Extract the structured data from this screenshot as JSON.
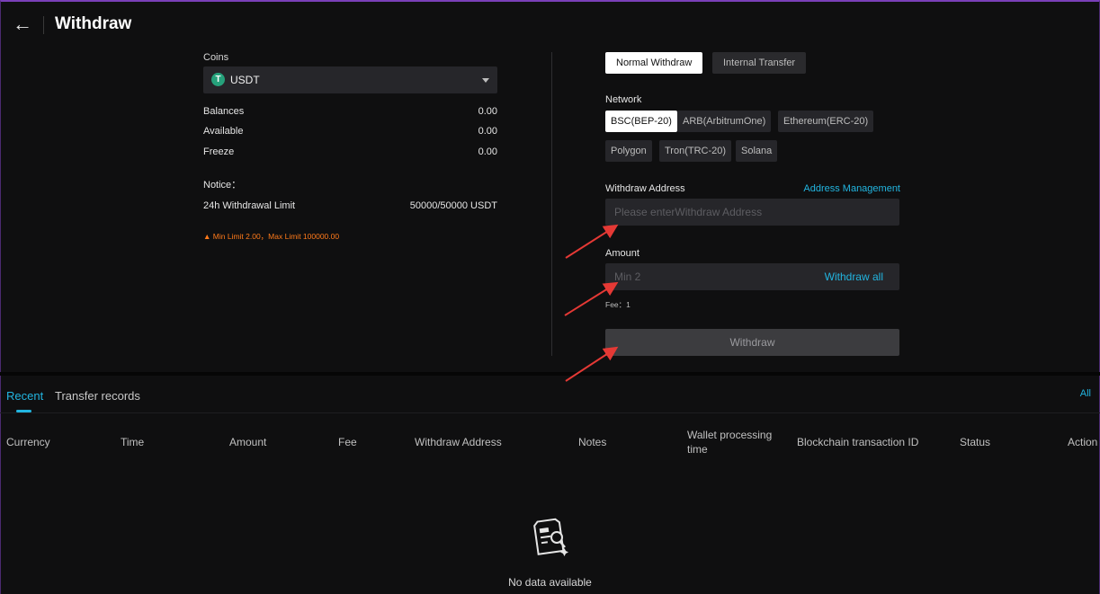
{
  "header": {
    "back_icon": "arrow-left-icon",
    "title": "Withdraw"
  },
  "left": {
    "coins_label": "Coins",
    "coin": {
      "symbol": "T",
      "name": "USDT",
      "icon": "tether-icon",
      "color": "#26a17b"
    },
    "balances": [
      {
        "label": "Balances",
        "value": "0.00"
      },
      {
        "label": "Available",
        "value": "0.00"
      },
      {
        "label": "Freeze",
        "value": "0.00"
      }
    ],
    "notice_label": "Notice：",
    "limit": {
      "label": "24h Withdrawal Limit",
      "value": "50000/50000 USDT"
    },
    "limit_warning": "▲ Min Limit 2.00，Max Limit 100000.00"
  },
  "right": {
    "tabs": [
      {
        "label": "Normal Withdraw",
        "active": true
      },
      {
        "label": "Internal Transfer",
        "active": false
      }
    ],
    "network_label": "Network",
    "networks": [
      {
        "label": "BSC(BEP-20)",
        "active": true
      },
      {
        "label": "ARB(ArbitrumOne)",
        "active": false
      },
      {
        "label": "Ethereum(ERC-20)",
        "active": false
      },
      {
        "label": "Polygon",
        "active": false
      },
      {
        "label": "Tron(TRC-20)",
        "active": false
      },
      {
        "label": "Solana",
        "active": false
      }
    ],
    "address_label": "Withdraw Address",
    "address_management": "Address Management",
    "address_placeholder": "Please enterWithdraw Address",
    "amount_label": "Amount",
    "amount_placeholder": "Min 2",
    "withdraw_all": "Withdraw all",
    "fee": "Fee：1",
    "withdraw_button": "Withdraw"
  },
  "records": {
    "tabs": [
      {
        "label": "Recent",
        "active": true
      },
      {
        "label": "Transfer records",
        "active": false
      }
    ],
    "all_link": "All",
    "columns": [
      "Currency",
      "Time",
      "Amount",
      "Fee",
      "Withdraw Address",
      "Notes",
      "Wallet processing time",
      "Blockchain transaction ID",
      "Status",
      "Action"
    ],
    "empty_icon": "no-data-icon",
    "empty_text": "No data available"
  },
  "colors": {
    "accent": "#22b5e0",
    "warning": "#ff7a1a",
    "annotation": "#e53935"
  }
}
